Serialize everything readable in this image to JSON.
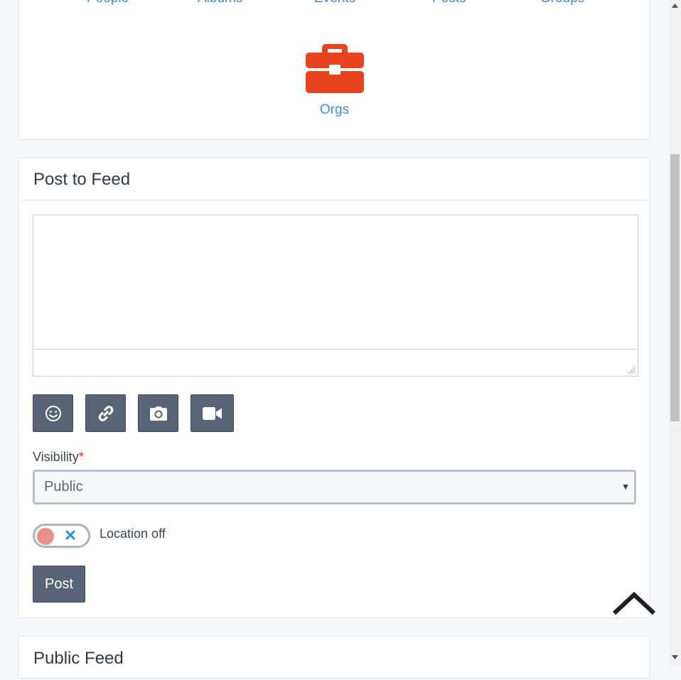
{
  "apps": {
    "top_links": [
      "People",
      "Albums",
      "Events",
      "Posts",
      "Groups"
    ],
    "orgs_label": "Orgs",
    "orgs_icon": "briefcase-icon",
    "orgs_color": "#e8431f"
  },
  "post_card": {
    "title": "Post to Feed",
    "textarea_value": "",
    "tools": [
      "emoji-icon",
      "link-icon",
      "camera-icon",
      "video-icon"
    ],
    "visibility_label": "Visibility",
    "required_mark": "*",
    "visibility_value": "Public",
    "location_label": "Location off",
    "post_label": "Post"
  },
  "feed_card": {
    "title": "Public Feed"
  },
  "colors": {
    "link": "#3a8fd6",
    "button": "#566475",
    "required": "#d9342b"
  }
}
